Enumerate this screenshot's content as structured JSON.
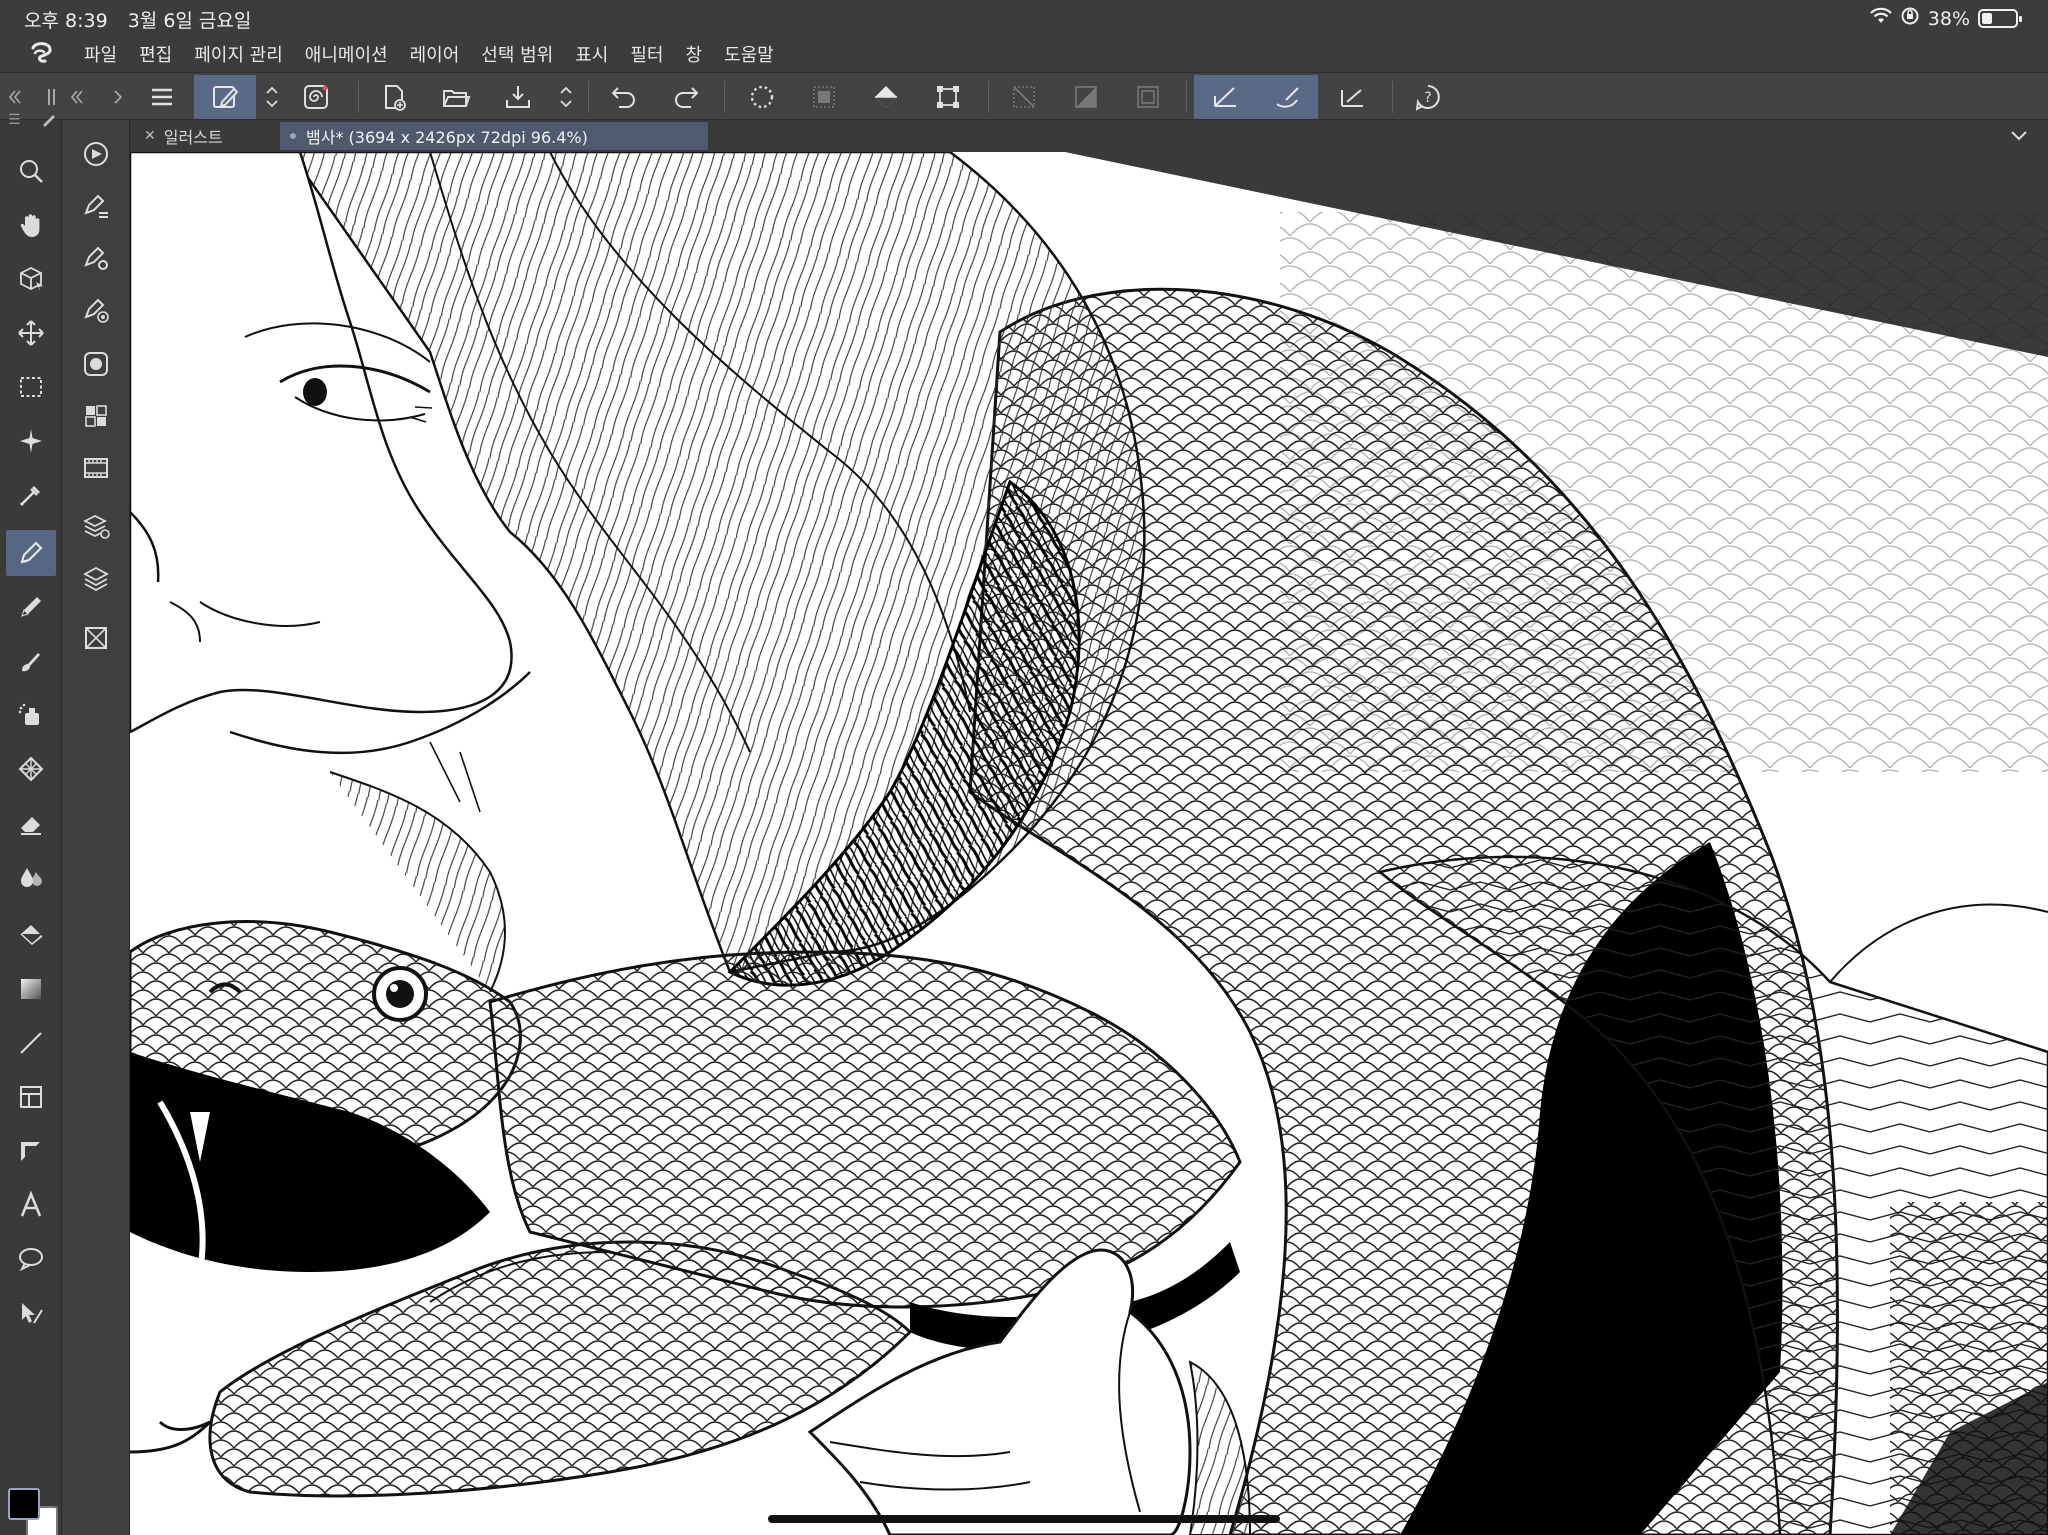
{
  "status": {
    "time": "오후 8:39",
    "date": "3월 6일 금요일",
    "battery": "38%",
    "battery_level": 0.38
  },
  "menu": [
    "파일",
    "편집",
    "페이지 관리",
    "애니메이션",
    "레이어",
    "선택 범위",
    "표시",
    "필터",
    "창",
    "도움말"
  ],
  "tabs": [
    {
      "label": "일러스트",
      "active": false
    },
    {
      "label": "뱀사* (3694 x 2426px 72dpi 96.4%)",
      "active": true
    }
  ],
  "colors": {
    "main": "#000000",
    "sub": "#ffffff",
    "accent": "#566683"
  },
  "toolbar_icons": [
    "hamburger-icon",
    "edit-pen-icon",
    "up-down-arrows-icon",
    "spiral-icon",
    "new-document-icon",
    "open-folder-icon",
    "save-icon",
    "up-down-arrows-icon",
    "undo-icon",
    "redo-icon",
    "dotted-circle-icon",
    "fill-selection-icon",
    "fill-bucket-icon",
    "transform-icon",
    "clear-selection-icon",
    "gradient-icon",
    "border-icon",
    "snap-ruler-icon",
    "snap-brush-icon",
    "ruler-icon",
    "help-icon"
  ],
  "tool_icons": [
    "magnifier-icon",
    "hand-icon",
    "3d-object-icon",
    "move-icon",
    "marquee-icon",
    "magic-wand-icon",
    "eyedropper-icon",
    "pen-icon",
    "pencil-icon",
    "brush-icon",
    "airbrush-icon",
    "pattern-icon",
    "eraser-icon",
    "blend-icon",
    "fill-icon",
    "gradient-icon",
    "line-icon",
    "frame-icon",
    "ruler-icon",
    "text-icon",
    "balloon-icon",
    "correct-line-icon"
  ]
}
